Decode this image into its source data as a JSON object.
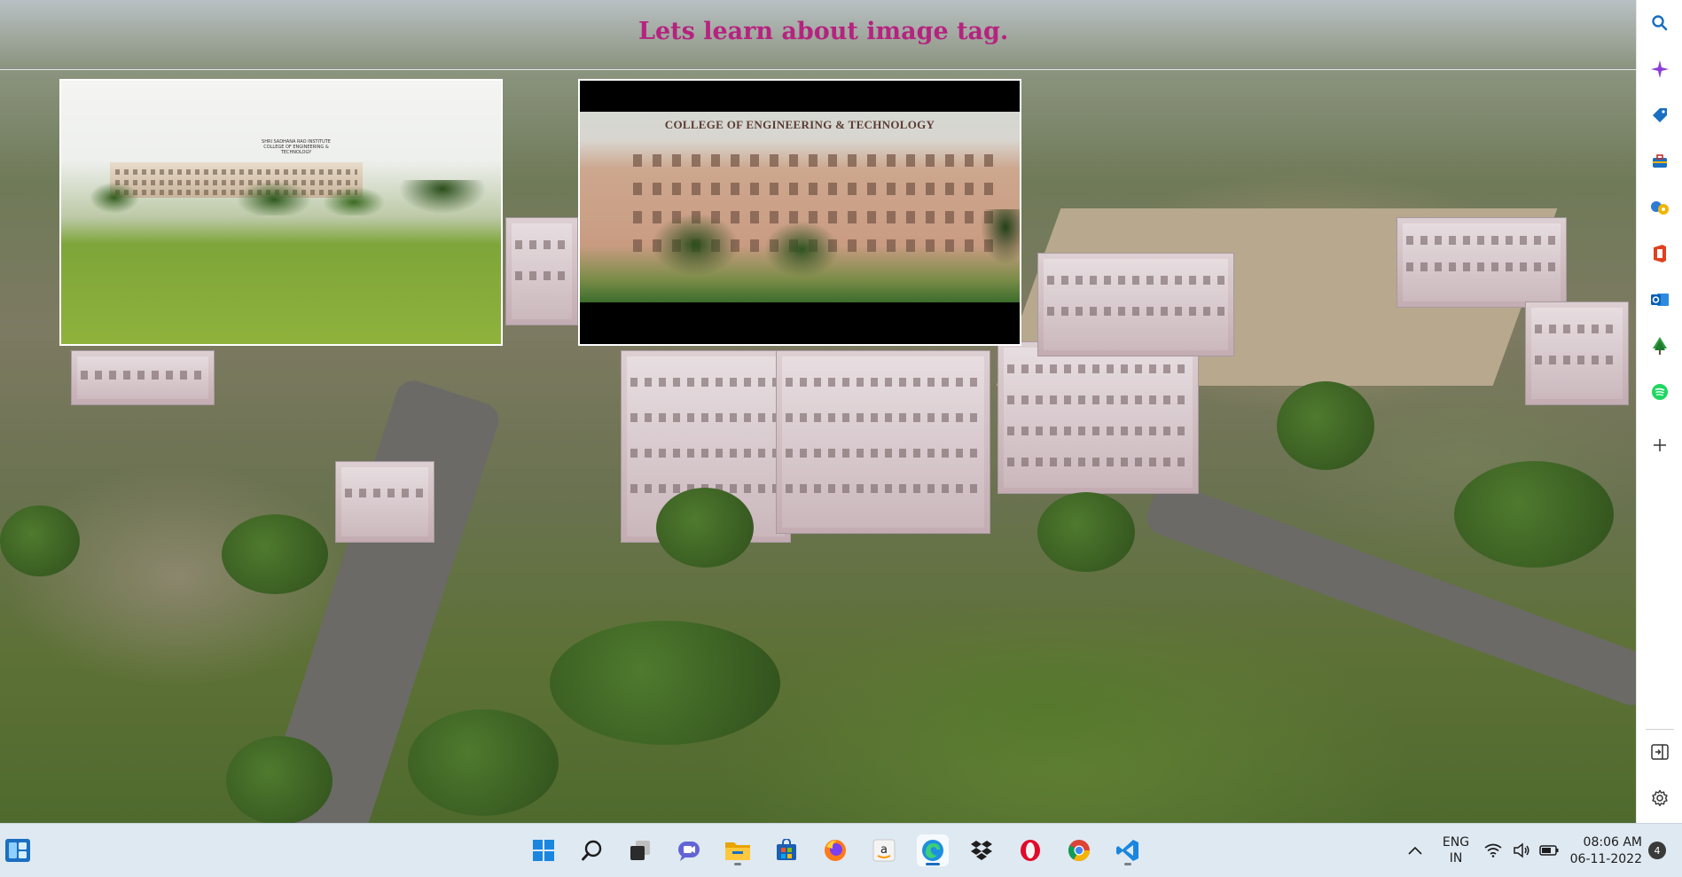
{
  "page": {
    "heading": "Lets learn about image tag."
  },
  "images": [
    {
      "name": "campus-photo-1",
      "sign": "SHRI SADHANA RAO INSTITUTE COLLEGE OF ENGINEERING & TECHNOLOGY"
    },
    {
      "name": "campus-photo-2",
      "sign": "COLLEGE OF ENGINEERING & TECHNOLOGY"
    }
  ],
  "sidebar": {
    "items": [
      "search-icon",
      "copilot-icon",
      "shopping-tag-icon",
      "tools-briefcase-icon",
      "games-icon",
      "office-icon",
      "outlook-icon",
      "tree-icon",
      "spotify-icon",
      "add-icon"
    ],
    "bottom": [
      "split-screen-icon",
      "settings-icon"
    ]
  },
  "taskbar": {
    "left": "widgets-icon",
    "apps": [
      "start-icon",
      "search-icon",
      "task-view-icon",
      "chat-icon",
      "file-explorer-icon",
      "store-icon",
      "firefox-icon",
      "amazon-icon",
      "edge-icon",
      "dropbox-icon",
      "opera-icon",
      "chrome-icon",
      "vscode-icon"
    ],
    "language_top": "ENG",
    "language_bottom": "IN",
    "time": "08:06 AM",
    "date": "06-11-2022",
    "notifications": "4"
  },
  "colors": {
    "heading": "#b5237f",
    "taskbar": "#dfe9f2"
  }
}
